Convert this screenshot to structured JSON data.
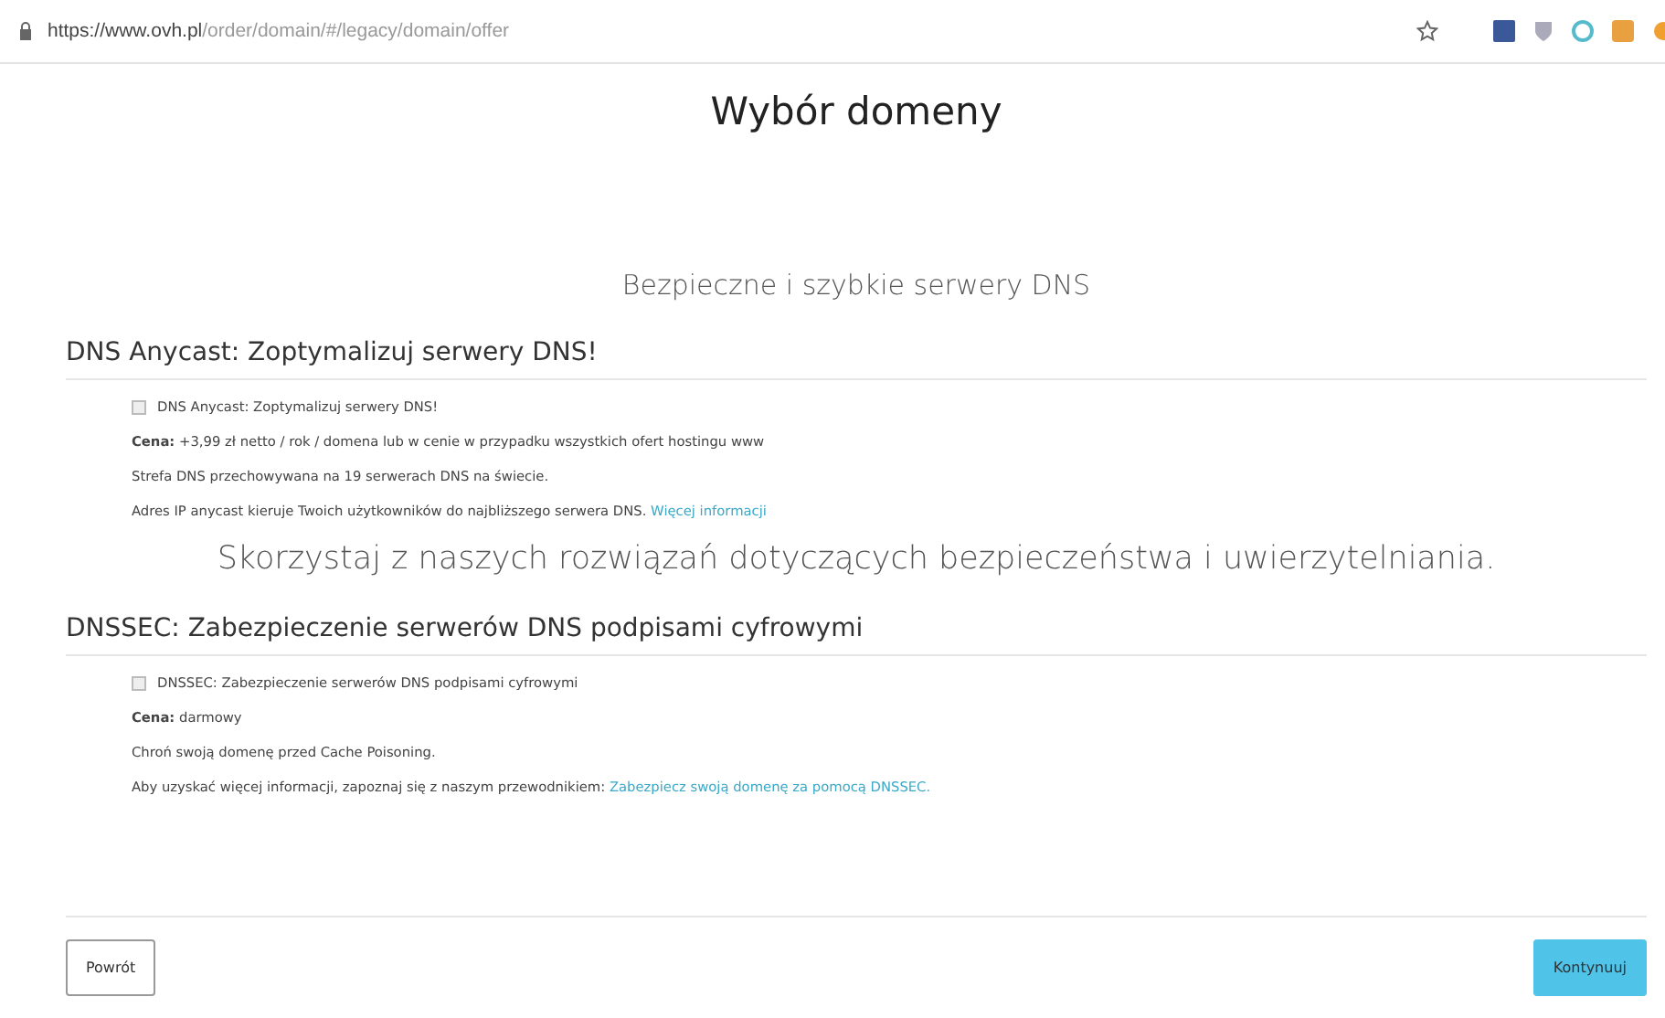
{
  "address_bar": {
    "url": "**https://www.ovh.pl**/order/domain/#/legacy/domain/offer"
  },
  "title": "Wybór domeny",
  "sections": [
    {
      "intro": "Bezpieczne i szybkie serwery DNS",
      "kind": "subtitle",
      "heading": "DNS Anycast: Zoptymalizuj serwery DNS!",
      "option": {
        "label": "DNS Anycast: Zoptymalizuj serwery DNS!",
        "checked": false
      },
      "price": "**Cena:** +3,99 zł netto / rok / domena lub w cenie w przypadku wszystkich ofert hostingu www",
      "lines": [
        "Strefa DNS przechowywana na 19 serwerach DNS na świecie."
      ],
      "info": {
        "text": "Adres IP anycast kieruje Twoich użytkowników do najbliższego serwera DNS.",
        "link": "Więcej informacji"
      }
    },
    {
      "intro": "Skorzystaj z naszych rozwiązań dotyczących bezpieczeństwa i uwierzytelniania.",
      "kind": "banner",
      "heading": "DNSSEC: Zabezpieczenie serwerów DNS podpisami cyfrowymi",
      "option": {
        "label": "DNSSEC: Zabezpieczenie serwerów DNS podpisami cyfrowymi",
        "checked": false
      },
      "price": "**Cena:** darmowy",
      "lines": [
        "Chroń swoją domenę przed Cache Poisoning."
      ],
      "info": {
        "text": "Aby uzyskać więcej informacji, zapoznaj się z naszym przewodnikiem:",
        "link": "Zabezpiecz swoją domenę za pomocą DNSSEC."
      }
    }
  ],
  "buttons": {
    "back": "Powrót",
    "next": "Kontynuuj"
  }
}
